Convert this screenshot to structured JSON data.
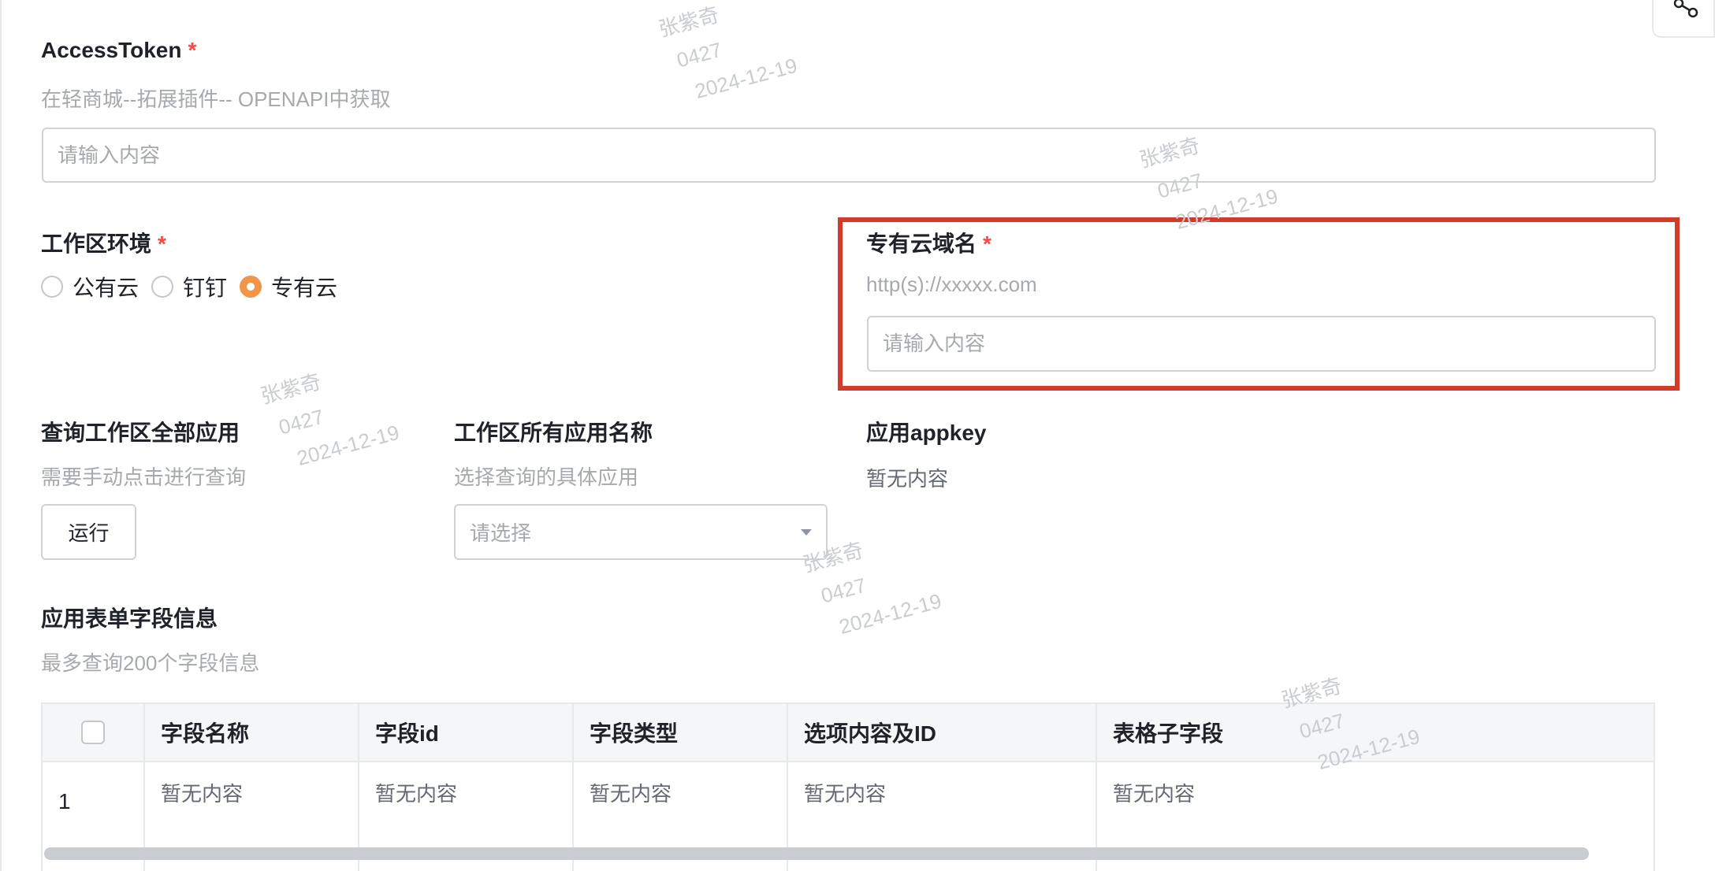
{
  "accesstoken": {
    "label": "AccessToken",
    "required_mark": "*",
    "description": "在轻商城--拓展插件-- OPENAPI中获取",
    "placeholder": "请输入内容"
  },
  "workspace_env": {
    "label": "工作区环境",
    "required_mark": "*",
    "options": [
      "公有云",
      "钉钉",
      "专有云"
    ],
    "selected": "专有云"
  },
  "private_cloud_domain": {
    "label": "专有云域名",
    "required_mark": "*",
    "description": "http(s)://xxxxx.com",
    "placeholder": "请输入内容"
  },
  "query_all_apps": {
    "label": "查询工作区全部应用",
    "description": "需要手动点击进行查询",
    "button_label": "运行"
  },
  "app_names": {
    "label": "工作区所有应用名称",
    "description": "选择查询的具体应用",
    "placeholder": "请选择"
  },
  "app_key": {
    "label": "应用appkey",
    "value": "暂无内容"
  },
  "form_fields": {
    "label": "应用表单字段信息",
    "description": "最多查询200个字段信息",
    "columns": [
      "字段名称",
      "字段id",
      "字段类型",
      "选项内容及ID",
      "表格子字段"
    ],
    "rows": [
      {
        "index": "1",
        "cells": [
          "暂无内容",
          "暂无内容",
          "暂无内容",
          "暂无内容",
          "暂无内容"
        ]
      }
    ]
  },
  "watermark": {
    "name": "张紫奇",
    "code": "0427",
    "date": "2024-12-19"
  },
  "colors": {
    "accent_radio": "#f0964a",
    "highlight_box": "#d23b2a",
    "required": "#f54a45"
  },
  "icons": {
    "share": "share-icon",
    "dropdown": "chevron-down-icon"
  }
}
